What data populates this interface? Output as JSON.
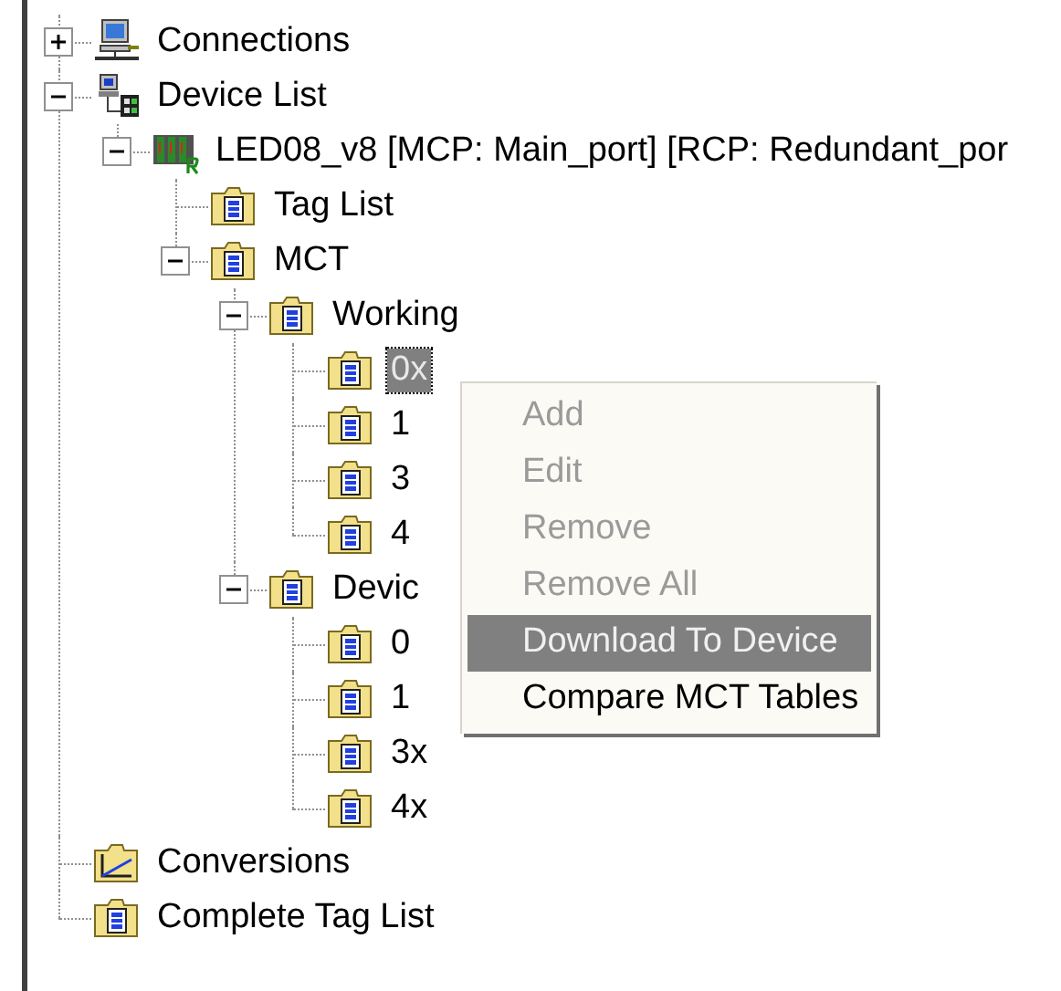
{
  "tree": [
    {
      "label": "Connections",
      "kind": "computer",
      "expanded": false,
      "selected": false
    },
    {
      "label": "Device List",
      "kind": "network",
      "expanded": true,
      "selected": false,
      "children": [
        {
          "label": "LED08_v8 [MCP: Main_port] [RCP: Redundant_por",
          "kind": "rack",
          "expanded": true,
          "selected": false,
          "children": [
            {
              "label": "Tag List",
              "kind": "folder",
              "selected": false
            },
            {
              "label": "MCT",
              "kind": "folder",
              "expanded": true,
              "selected": false,
              "children": [
                {
                  "label": "Working",
                  "kind": "folder",
                  "expanded": true,
                  "selected": false,
                  "children": [
                    {
                      "label": "0x",
                      "kind": "folder",
                      "selected": true
                    },
                    {
                      "label": "1",
                      "kind": "folder",
                      "selected": false
                    },
                    {
                      "label": "3",
                      "kind": "folder",
                      "selected": false
                    },
                    {
                      "label": "4",
                      "kind": "folder",
                      "selected": false
                    }
                  ]
                },
                {
                  "label": "Devic",
                  "kind": "folder",
                  "expanded": true,
                  "selected": false,
                  "children": [
                    {
                      "label": "0",
                      "kind": "folder",
                      "selected": false
                    },
                    {
                      "label": "1",
                      "kind": "folder",
                      "selected": false
                    },
                    {
                      "label": "3x",
                      "kind": "folder",
                      "selected": false
                    },
                    {
                      "label": "4x",
                      "kind": "folder",
                      "selected": false
                    }
                  ]
                }
              ]
            }
          ]
        }
      ]
    },
    {
      "label": "Conversions",
      "kind": "chart-folder",
      "selected": false
    },
    {
      "label": "Complete Tag List",
      "kind": "folder",
      "selected": false
    }
  ],
  "context_menu": [
    {
      "label": "Add",
      "disabled": true,
      "selected": false
    },
    {
      "label": "Edit",
      "disabled": true,
      "selected": false
    },
    {
      "label": "Remove",
      "disabled": true,
      "selected": false
    },
    {
      "label": "Remove All",
      "disabled": true,
      "selected": false
    },
    {
      "label": "Download To Device",
      "disabled": false,
      "selected": true
    },
    {
      "label": "Compare MCT Tables",
      "disabled": false,
      "selected": false
    }
  ]
}
